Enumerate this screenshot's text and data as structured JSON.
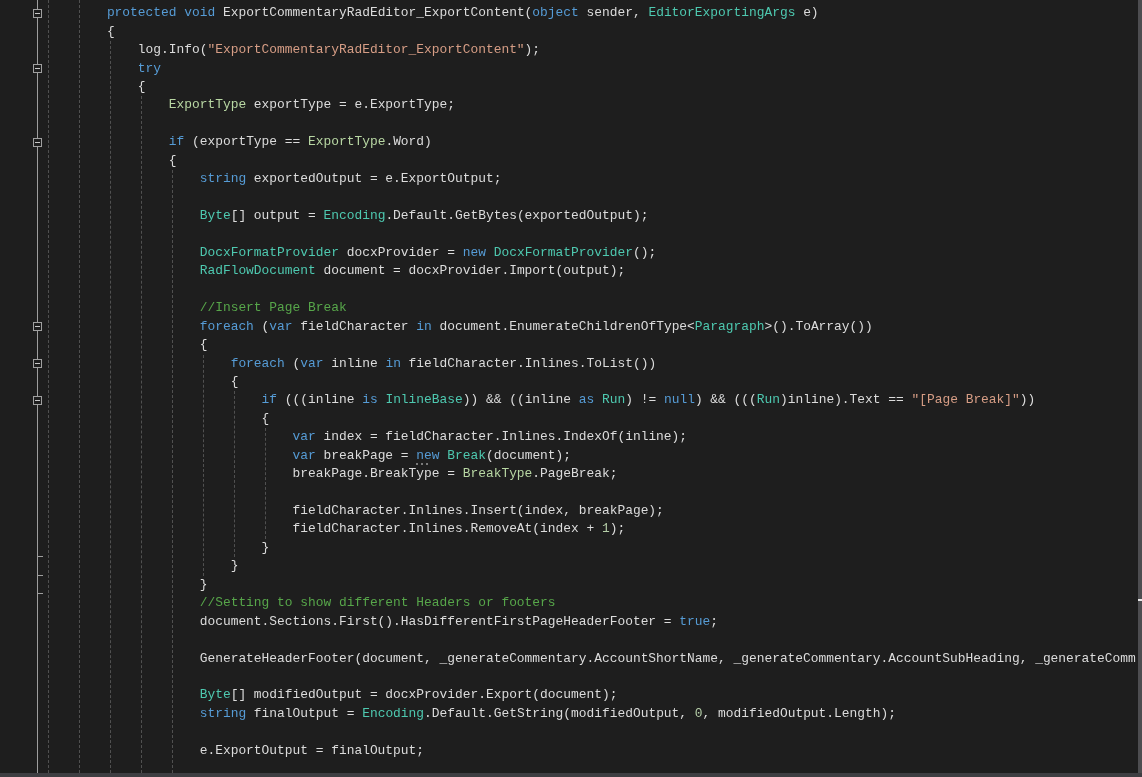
{
  "editor": {
    "lines": [
      {
        "expanded": true,
        "tokens": [
          {
            "kind": "keyword",
            "text": "protected void"
          },
          {
            "kind": "plain",
            "text": " ExportCommentaryRadEditor_ExportContent("
          },
          {
            "kind": "keyword",
            "text": "object"
          },
          {
            "kind": "plain",
            "text": " sender, "
          },
          {
            "kind": "type",
            "text": "EditorExportingArgs"
          },
          {
            "kind": "plain",
            "text": " e)"
          }
        ]
      },
      {
        "tokens": [
          {
            "kind": "plain",
            "text": "{"
          }
        ],
        "children": [
          [
            {
              "tokens": [
                {
                  "kind": "plain",
                  "text": "log.Info("
                },
                {
                  "kind": "string",
                  "text": "\"ExportCommentaryRadEditor_ExportContent\""
                },
                {
                  "kind": "plain",
                  "text": ");"
                }
              ]
            },
            {
              "expanded": true,
              "tokens": [
                {
                  "kind": "keyword",
                  "text": "try"
                }
              ]
            },
            {
              "tokens": [
                {
                  "kind": "plain",
                  "text": "{"
                }
              ],
              "children": [
                [
                  {
                    "tokens": [
                      {
                        "kind": "enum",
                        "text": "ExportType"
                      },
                      {
                        "kind": "plain",
                        "text": " exportType = e.ExportType;"
                      }
                    ]
                  }
                ],
                [
                  {
                    "expanded": true,
                    "tokens": [
                      {
                        "kind": "keyword",
                        "text": "if"
                      },
                      {
                        "kind": "plain",
                        "text": " (exportType == "
                      },
                      {
                        "kind": "enum",
                        "text": "ExportType"
                      },
                      {
                        "kind": "plain",
                        "text": ".Word)"
                      }
                    ]
                  },
                  {
                    "tokens": [
                      {
                        "kind": "plain",
                        "text": "{"
                      }
                    ],
                    "children": [
                      [
                        {
                          "tokens": [
                            {
                              "kind": "keyword",
                              "text": "string"
                            },
                            {
                              "kind": "plain",
                              "text": " exportedOutput = e.ExportOutput;"
                            }
                          ]
                        }
                      ],
                      [
                        {
                          "tokens": [
                            {
                              "kind": "type",
                              "text": "Byte"
                            },
                            {
                              "kind": "plain",
                              "text": "[] output = "
                            },
                            {
                              "kind": "type",
                              "text": "Encoding"
                            },
                            {
                              "kind": "plain",
                              "text": ".Default.GetBytes(exportedOutput);"
                            }
                          ]
                        }
                      ],
                      [
                        {
                          "tokens": [
                            {
                              "kind": "type",
                              "text": "DocxFormatProvider"
                            },
                            {
                              "kind": "plain",
                              "text": " docxProvider = "
                            },
                            {
                              "kind": "keyword",
                              "text": "new "
                            },
                            {
                              "kind": "type",
                              "text": "DocxFormatProvider"
                            },
                            {
                              "kind": "plain",
                              "text": "();"
                            }
                          ]
                        },
                        {
                          "tokens": [
                            {
                              "kind": "type",
                              "text": "RadFlowDocument"
                            },
                            {
                              "kind": "plain",
                              "text": " document = docxProvider.Import(output);"
                            }
                          ]
                        }
                      ],
                      [
                        {
                          "tokens": [
                            {
                              "kind": "comment",
                              "text": "//Insert Page Break"
                            }
                          ]
                        },
                        {
                          "expanded": true,
                          "tokens": [
                            {
                              "kind": "keyword",
                              "text": "foreach"
                            },
                            {
                              "kind": "plain",
                              "text": " ("
                            },
                            {
                              "kind": "keyword",
                              "text": "var"
                            },
                            {
                              "kind": "plain",
                              "text": " fieldCharacter "
                            },
                            {
                              "kind": "keyword",
                              "text": "in"
                            },
                            {
                              "kind": "plain",
                              "text": " document.EnumerateChildrenOfType<"
                            },
                            {
                              "kind": "type",
                              "text": "Paragraph"
                            },
                            {
                              "kind": "plain",
                              "text": ">().ToArray())"
                            }
                          ]
                        },
                        {
                          "tokens": [
                            {
                              "kind": "plain",
                              "text": "{"
                            }
                          ],
                          "children": [
                            [
                              {
                                "expanded": true,
                                "tokens": [
                                  {
                                    "kind": "keyword",
                                    "text": "foreach"
                                  },
                                  {
                                    "kind": "plain",
                                    "text": " ("
                                  },
                                  {
                                    "kind": "keyword",
                                    "text": "var"
                                  },
                                  {
                                    "kind": "plain",
                                    "text": " inline "
                                  },
                                  {
                                    "kind": "keyword",
                                    "text": "in"
                                  },
                                  {
                                    "kind": "plain",
                                    "text": " fieldCharacter.Inlines.ToList())"
                                  }
                                ]
                              },
                              {
                                "tokens": [
                                  {
                                    "kind": "plain",
                                    "text": "{"
                                  }
                                ],
                                "children": [
                                  [
                                    {
                                      "expanded": true,
                                      "tokens": [
                                        {
                                          "kind": "keyword",
                                          "text": "if"
                                        },
                                        {
                                          "kind": "plain",
                                          "text": " (((inline "
                                        },
                                        {
                                          "kind": "keyword",
                                          "text": "is "
                                        },
                                        {
                                          "kind": "type",
                                          "text": "InlineBase"
                                        },
                                        {
                                          "kind": "plain",
                                          "text": ")) && ((inline "
                                        },
                                        {
                                          "kind": "keyword",
                                          "text": "as "
                                        },
                                        {
                                          "kind": "type",
                                          "text": "Run"
                                        },
                                        {
                                          "kind": "plain",
                                          "text": ") != "
                                        },
                                        {
                                          "kind": "keyword",
                                          "text": "null"
                                        },
                                        {
                                          "kind": "plain",
                                          "text": ") && ((("
                                        },
                                        {
                                          "kind": "type",
                                          "text": "Run"
                                        },
                                        {
                                          "kind": "plain",
                                          "text": ")inline).Text == "
                                        },
                                        {
                                          "kind": "string",
                                          "text": "\"[Page Break]\""
                                        },
                                        {
                                          "kind": "plain",
                                          "text": "))"
                                        }
                                      ]
                                    },
                                    {
                                      "tokens": [
                                        {
                                          "kind": "plain",
                                          "text": "{"
                                        }
                                      ],
                                      "children": [
                                        [
                                          {
                                            "tokens": [
                                              {
                                                "kind": "keyword",
                                                "text": "var"
                                              },
                                              {
                                                "kind": "plain",
                                                "text": " index = fieldCharacter.Inlines.IndexOf(inline);"
                                              }
                                            ]
                                          },
                                          {
                                            "tokens": [
                                              {
                                                "kind": "keyword",
                                                "text": "var"
                                              },
                                              {
                                                "kind": "plain",
                                                "text": " breakPage = "
                                              },
                                              {
                                                "kind": "keyword-hinted",
                                                "text": "new "
                                              },
                                              {
                                                "kind": "type",
                                                "text": "Break"
                                              },
                                              {
                                                "kind": "plain",
                                                "text": "(document);"
                                              }
                                            ]
                                          },
                                          {
                                            "tokens": [
                                              {
                                                "kind": "plain",
                                                "text": "breakPage.BreakType = "
                                              },
                                              {
                                                "kind": "enum",
                                                "text": "BreakType"
                                              },
                                              {
                                                "kind": "plain",
                                                "text": ".PageBreak;"
                                              }
                                            ]
                                          }
                                        ],
                                        [
                                          {
                                            "tokens": [
                                              {
                                                "kind": "plain",
                                                "text": "fieldCharacter.Inlines.Insert(index, breakPage);"
                                              }
                                            ]
                                          },
                                          {
                                            "tokens": [
                                              {
                                                "kind": "plain",
                                                "text": "fieldCharacter.Inlines.RemoveAt(index + "
                                              },
                                              {
                                                "kind": "number",
                                                "text": "1"
                                              },
                                              {
                                                "kind": "plain",
                                                "text": ");"
                                              }
                                            ]
                                          }
                                        ]
                                      ]
                                    },
                                    {
                                      "tokens": [
                                        {
                                          "kind": "plain",
                                          "text": "}"
                                        }
                                      ]
                                    }
                                  ]
                                ]
                              },
                              {
                                "tokens": [
                                  {
                                    "kind": "plain",
                                    "text": "}"
                                  }
                                ]
                              }
                            ]
                          ]
                        },
                        {
                          "tokens": [
                            {
                              "kind": "plain",
                              "text": "}"
                            }
                          ]
                        },
                        {
                          "tokens": [
                            {
                              "kind": "comment",
                              "text": "//Setting to show different Headers or footers"
                            }
                          ]
                        },
                        {
                          "tokens": [
                            {
                              "kind": "plain",
                              "text": "document.Sections.First().HasDifferentFirstPageHeaderFooter = "
                            },
                            {
                              "kind": "keyword",
                              "text": "true"
                            },
                            {
                              "kind": "plain",
                              "text": ";"
                            }
                          ]
                        }
                      ],
                      [
                        {
                          "tokens": [
                            {
                              "kind": "plain",
                              "text": "GenerateHeaderFooter(document, _generateCommentary.AccountShortName, _generateCommentary.AccountSubHeading, _generateComm"
                            }
                          ]
                        }
                      ],
                      [
                        {
                          "tokens": [
                            {
                              "kind": "type",
                              "text": "Byte"
                            },
                            {
                              "kind": "plain",
                              "text": "[] modifiedOutput = docxProvider.Export(document);"
                            }
                          ]
                        },
                        {
                          "tokens": [
                            {
                              "kind": "keyword",
                              "text": "string"
                            },
                            {
                              "kind": "plain",
                              "text": " finalOutput = "
                            },
                            {
                              "kind": "type",
                              "text": "Encoding"
                            },
                            {
                              "kind": "plain",
                              "text": ".Default.GetString(modifiedOutput, "
                            },
                            {
                              "kind": "number",
                              "text": "0"
                            },
                            {
                              "kind": "plain",
                              "text": ", modifiedOutput.Length);"
                            }
                          ]
                        }
                      ],
                      [
                        {
                          "tokens": [
                            {
                              "kind": "plain",
                              "text": "e.ExportOutput = finalOutput;"
                            }
                          ]
                        }
                      ]
                    ]
                  }
                ]
              ]
            }
          ]
        ]
      }
    ]
  }
}
